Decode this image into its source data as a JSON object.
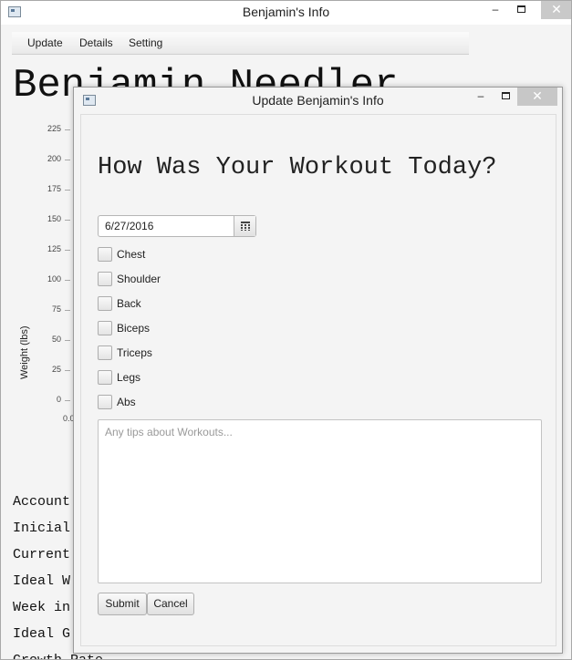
{
  "main_window": {
    "title": "Benjamin's Info",
    "menu": [
      "Update",
      "Details",
      "Setting"
    ],
    "name_heading": "Benjamin Needler",
    "chart": {
      "ylabel": "Weight (lbs)",
      "y_ticks": [
        "225",
        "200",
        "175",
        "150",
        "125",
        "100",
        "75",
        "50",
        "25",
        "0"
      ],
      "x_start": "0.0"
    },
    "info_lines": [
      "Account",
      "Inicial",
      "Current",
      "Ideal W",
      "Week in",
      "Ideal G",
      "Growth Rate"
    ]
  },
  "dialog": {
    "title": "Update Benjamin's Info",
    "heading": "How Was Your Workout Today?",
    "date_value": "6/27/2016",
    "checkboxes": [
      {
        "label": "Chest",
        "checked": false
      },
      {
        "label": "Shoulder",
        "checked": false
      },
      {
        "label": "Back",
        "checked": false
      },
      {
        "label": "Biceps",
        "checked": false
      },
      {
        "label": "Triceps",
        "checked": false
      },
      {
        "label": "Legs",
        "checked": false
      },
      {
        "label": "Abs",
        "checked": false
      }
    ],
    "tips_placeholder": "Any tips about Workouts...",
    "submit_label": "Submit",
    "cancel_label": "Cancel"
  },
  "window_controls": {
    "minimize": "–",
    "close": "✕"
  }
}
